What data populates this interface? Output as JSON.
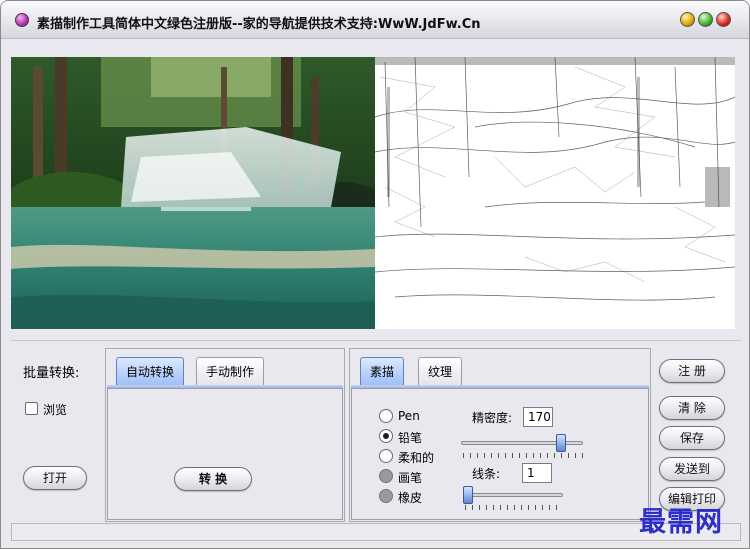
{
  "window": {
    "title": "素描制作工具简体中文绿色注册版--家的导航提供技术支持:WwW.JdFw.Cn"
  },
  "left_panel": {
    "batch_label": "批量转换:",
    "browse_label": "浏览",
    "browse_checked": false,
    "open_label": "打开"
  },
  "mode_panel": {
    "tabs": [
      {
        "label": "自动转换",
        "active": true
      },
      {
        "label": "手动制作",
        "active": false
      }
    ],
    "convert_label": "转  换"
  },
  "style_panel": {
    "tabs": [
      {
        "label": "素描",
        "active": true
      },
      {
        "label": "纹理",
        "active": false
      }
    ],
    "tools": [
      {
        "label": "Pen",
        "checked": false,
        "enabled": true
      },
      {
        "label": "铅笔",
        "checked": true,
        "enabled": true
      },
      {
        "label": "柔和的",
        "checked": false,
        "enabled": true
      },
      {
        "label": "画笔",
        "checked": false,
        "enabled": false
      },
      {
        "label": "橡皮",
        "checked": false,
        "enabled": false
      }
    ],
    "density_label": "精密度:",
    "density_value": "170",
    "density_fraction": 0.85,
    "lines_label": "线条:",
    "lines_value": "1",
    "lines_fraction": 0.0
  },
  "actions": {
    "register": "注 册",
    "clear": "清 除",
    "save": "保存",
    "send": "发送到",
    "print": "编辑打印"
  },
  "watermark": "最需网",
  "colors": {
    "active_tab": "#9fc0f7",
    "watermark": "#2d2dc8"
  }
}
